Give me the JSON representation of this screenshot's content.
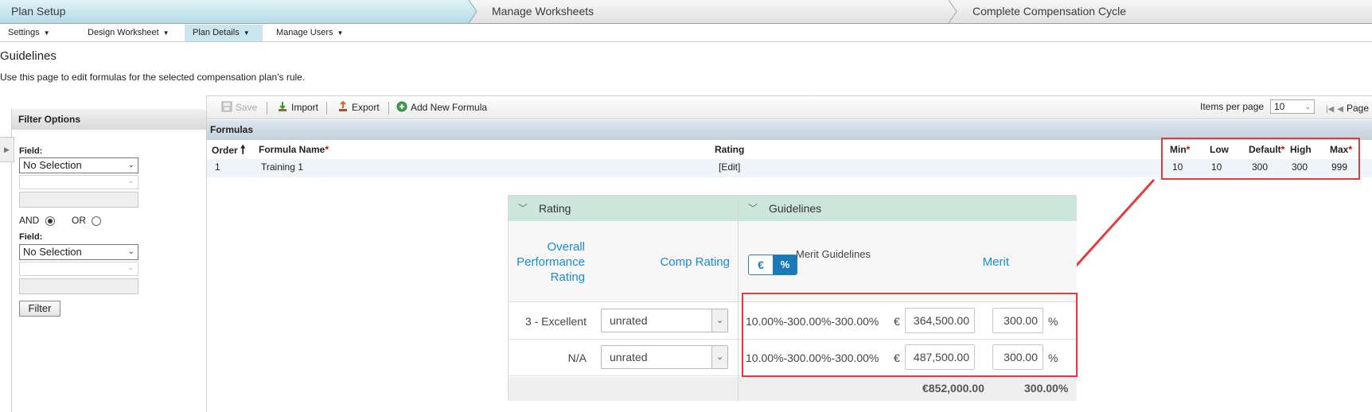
{
  "wizard": {
    "steps": [
      "Plan Setup",
      "Manage Worksheets",
      "Complete Compensation Cycle"
    ]
  },
  "nav": {
    "items": [
      "Settings",
      "Design Worksheet",
      "Plan Details",
      "Manage Users"
    ]
  },
  "page": {
    "title": "Guidelines",
    "description": "Use this page to edit formulas for the selected compensation plan's rule."
  },
  "filter": {
    "header": "Filter Options",
    "field_label": "Field:",
    "field1_value": "No Selection",
    "and_label": "AND",
    "or_label": "OR",
    "field2_label": "Field:",
    "field2_value": "No Selection",
    "button": "Filter"
  },
  "toolbar": {
    "save": "Save",
    "import": "Import",
    "export": "Export",
    "add_formula": "Add New Formula",
    "items_per_page_label": "Items per page",
    "items_per_page_value": "10",
    "page_label": "Page"
  },
  "grid": {
    "section_title": "Formulas",
    "columns": {
      "order": "Order",
      "formula_name": "Formula Name",
      "rating": "Rating",
      "min": "Min",
      "low": "Low",
      "default": "Default",
      "high": "High",
      "max": "Max",
      "required_mark": "*"
    },
    "rows": [
      {
        "order": "1",
        "formula_name": "Training 1",
        "rating": "[Edit]",
        "min": "10",
        "low": "10",
        "default": "300",
        "high": "300",
        "max": "999"
      }
    ]
  },
  "rating_table": {
    "header_rating": "Rating",
    "header_guidelines": "Guidelines",
    "col_overall_line1": "Overall",
    "col_overall_line2": "Performance",
    "col_overall_line3": "Rating",
    "col_comp_rating": "Comp Rating",
    "toggle_currency": "€",
    "toggle_percent": "%",
    "col_merit_guidelines": "Merit Guidelines",
    "col_merit": "Merit",
    "rows": [
      {
        "rating": "3 - Excellent",
        "comp_rating": "unrated",
        "guidelines": "10.00%-300.00%-300.00%",
        "currency": "€",
        "amount": "364,500.00",
        "percent": "300.00",
        "pct_sign": "%"
      },
      {
        "rating": "N/A",
        "comp_rating": "unrated",
        "guidelines": "10.00%-300.00%-300.00%",
        "currency": "€",
        "amount": "487,500.00",
        "percent": "300.00",
        "pct_sign": "%"
      }
    ],
    "total_amount": "€852,000.00",
    "total_percent": "300.00%"
  },
  "colors": {
    "accent_blue": "#1a8bd1",
    "highlight_red": "#e03c3c",
    "header_green": "#cde6dc"
  }
}
